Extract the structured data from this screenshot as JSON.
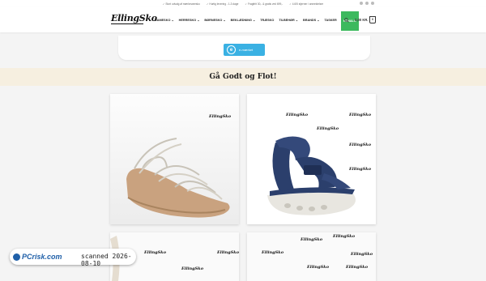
{
  "topbar": {
    "items": [
      "✓ Stort udvalg af mærkevaresko",
      "✓ Hurtig levering - 1-3 dage",
      "✓ Fragtfrit 30,- & gratis ved 699,-",
      "✓ 4.6/5 stjerner i anmeldelser"
    ]
  },
  "header": {
    "logo": "EllingSko",
    "nav": [
      "DAMESKO ⌄",
      "HERRESKO ⌄",
      "BØRNESKO ⌄",
      "BEKLÆDNING ⌄",
      "TRÆSKO",
      "TILBEHØR ⌄",
      "BRANDS ⌄",
      "TASKER",
      "HENALG"
    ],
    "cart_total": "0,00 KR.",
    "cart_count": "0"
  },
  "emaerket": {
    "label": "e-mærket"
  },
  "banner": {
    "title": "Gå Godt og Flot!"
  },
  "products": [
    {
      "watermark": "EllingSko"
    },
    {
      "watermark": "EllingSko"
    },
    {
      "watermark": "EllingSko"
    },
    {
      "watermark": "EllingSko"
    }
  ],
  "scanner": {
    "logo": "PCrisk.com",
    "text": "scanned 2026-08-10"
  },
  "colors": {
    "sale_green": "#3cb95e",
    "emaerket_blue": "#3ab1e3",
    "banner_bg": "#f6efe0"
  }
}
